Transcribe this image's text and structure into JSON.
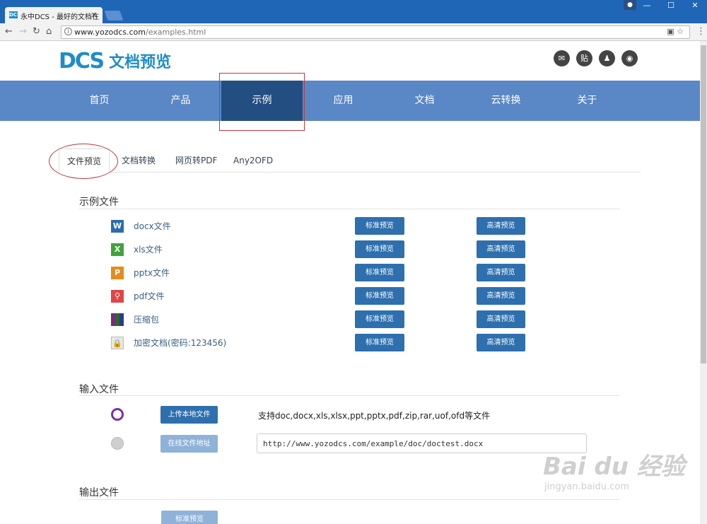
{
  "browser": {
    "tab_title": "永中DCS - 最好的文档在",
    "tab_favicon": "DCS",
    "tab_close": "×",
    "url_host": "www.yozodcs.com",
    "url_path": "/examples.html"
  },
  "site": {
    "logo_mark": "DCS",
    "logo_text": "文档预览",
    "social": [
      {
        "icon": "wechat-icon",
        "glyph": "✉"
      },
      {
        "icon": "tieba-icon",
        "glyph": "贴"
      },
      {
        "icon": "qq-icon",
        "glyph": "♟"
      },
      {
        "icon": "weibo-icon",
        "glyph": "◉"
      }
    ]
  },
  "nav": {
    "items": [
      "首页",
      "产品",
      "示例",
      "应用",
      "文档",
      "云转换",
      "关于"
    ],
    "active": "示例"
  },
  "subtabs": [
    "文件预览",
    "文档转换",
    "网页转PDF",
    "Any2OFD"
  ],
  "examples": {
    "title": "示例文件",
    "std_label": "标准预览",
    "hd_label": "高清预览",
    "files": [
      {
        "name": "docx文件",
        "icon": "word-icon"
      },
      {
        "name": "xls文件",
        "icon": "excel-icon"
      },
      {
        "name": "pptx文件",
        "icon": "ppt-icon"
      },
      {
        "name": "pdf文件",
        "icon": "pdf-icon"
      },
      {
        "name": "压缩包",
        "icon": "archive-icon"
      },
      {
        "name": "加密文档(密码:123456)",
        "icon": "locked-doc-icon"
      }
    ]
  },
  "input": {
    "title": "输入文件",
    "upload_label": "上传本地文件",
    "online_label": "在线文件地址",
    "support_text": "支持doc,docx,xls,xlsx,ppt,pptx,pdf,zip,rar,uof,ofd等文件",
    "url_value": "http://www.yozodcs.com/example/doc/doctest.docx"
  },
  "output": {
    "title": "输出文件",
    "preview_label": "标准预览"
  },
  "watermark": {
    "text": "Bai du 经验",
    "sub": "jingyan.baidu.com"
  }
}
